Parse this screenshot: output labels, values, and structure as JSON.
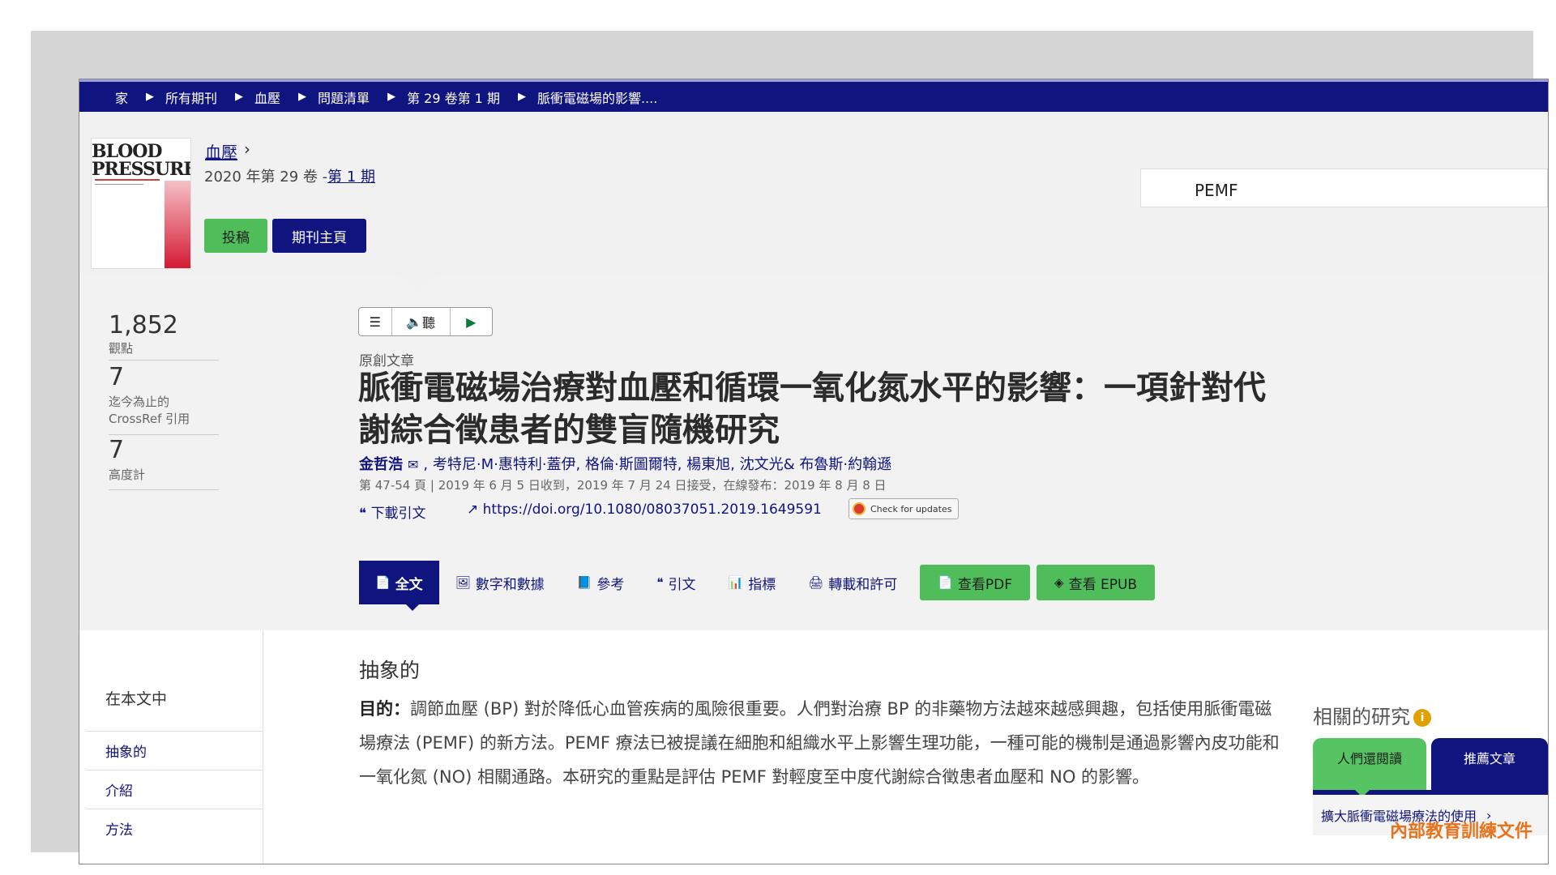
{
  "breadcrumb": [
    "家",
    "所有期刊",
    "血壓",
    "問題清單",
    "第 29 卷第 1 期",
    "脈衝電磁場的影響...."
  ],
  "journal": {
    "cover_title_line1": "BLOOD",
    "cover_title_line2": "PRESSURE",
    "name": "血壓",
    "issue_prefix": "2020 年第 29 卷 -",
    "issue_link": "第 1 期",
    "submit_label": "投稿",
    "home_label": "期刊主頁"
  },
  "search": {
    "value": "PEMF"
  },
  "metrics": [
    {
      "value": "1,852",
      "label": "觀點"
    },
    {
      "value": "7",
      "label_line1": "迄今為止的",
      "label_line2": "CrossRef 引用"
    },
    {
      "value": "7",
      "label": "高度計"
    }
  ],
  "toolbar": {
    "listen_label": "聽"
  },
  "article": {
    "type": "原創文章",
    "title": "脈衝電磁場治療對血壓和循環一氧化氮水平的影響：一項針對代謝綜合徵患者的雙盲隨機研究",
    "first_author": "金哲浩",
    "other_authors": ", 考特尼·M·惠特利·蓋伊, 格倫·斯圖爾特, 楊東旭, 沈文光& 布魯斯·約翰遜",
    "dates": "第 47-54 頁 | 2019 年 6 月 5 日收到，2019 年 7 月 24 日接受，在線發布：2019 年 8 月 8 日",
    "cite_label": "下載引文",
    "doi": "https://doi.org/10.1080/08037051.2019.1649591",
    "check_updates": "Check for updates"
  },
  "tabs": [
    "全文",
    "數字和數據",
    "參考",
    "引文",
    "指標",
    "轉載和許可",
    "查看PDF",
    "查看 EPUB"
  ],
  "toc": {
    "title": "在本文中",
    "items": [
      "抽象的",
      "介紹",
      "方法"
    ]
  },
  "abstract": {
    "heading": "抽象的",
    "lead": "目的：",
    "text": "調節血壓 (BP) 對於降低心血管疾病的風險很重要。人們對治療 BP 的非藥物方法越來越感興趣，包括使用脈衝電磁場療法 (PEMF) 的新方法。PEMF 療法已被提議在細胞和組織水平上影響生理功能，一種可能的機制是通過影響內皮功能和一氧化氮 (NO) 相關通路。本研究的重點是評估 PEMF 對輕度至中度代謝綜合徵患者血壓和 NO 的影響。"
  },
  "related": {
    "title": "相關的研究",
    "tab1": "人們還閱讀",
    "tab2": "推薦文章",
    "item": "擴大脈衝電磁場療法的使用"
  },
  "watermark": "內部教育訓練文件",
  "colors": {
    "navy": "#10147e",
    "green": "#4fbe5a",
    "orange": "#e8731c"
  }
}
